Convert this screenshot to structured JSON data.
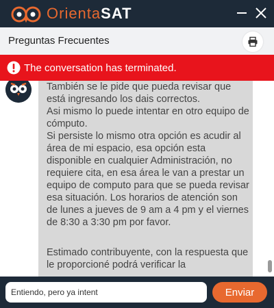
{
  "app": {
    "brand_part1": "Orienta",
    "brand_part2": "SAT",
    "icons": {
      "logo": "owl-logo-icon",
      "minimize": "minimize-icon",
      "close": "close-icon"
    },
    "colors": {
      "titlebar": "#1d2a38",
      "accent": "#e8692f"
    }
  },
  "header": {
    "title": "Preguntas Frecuentes",
    "print_icon": "printer-icon"
  },
  "alert": {
    "text": "The conversation has terminated.",
    "icon": "exclamation-circle-icon",
    "color": "#e8141c"
  },
  "chat": {
    "bot_avatar_icon": "owl-avatar-icon",
    "message": {
      "paragraphs": [
        "También se le pide que pueda revisar que está ingresando los dais correctos.",
        "Asi mismo lo puede intentar en otro equipo de cómputo.",
        "Si persiste lo mismo otra opción es acudir al área de mi espacio, esa opción esta disponible en cualquier Administración, no requiere cita, en esa área le van a prestar un equipo de computo para que se pueda revisar esa situación. Los horarios de atención son de lunes a jueves de 9 am a 4 pm y el viernes de 8:30 a 3:30 pm por favor.",
        "Estimado contribuyente, con la respuesta que le proporcioné podrá verificar la"
      ]
    }
  },
  "composer": {
    "input_value": "Entiendo, pero ya intent",
    "send_label": "Enviar"
  }
}
